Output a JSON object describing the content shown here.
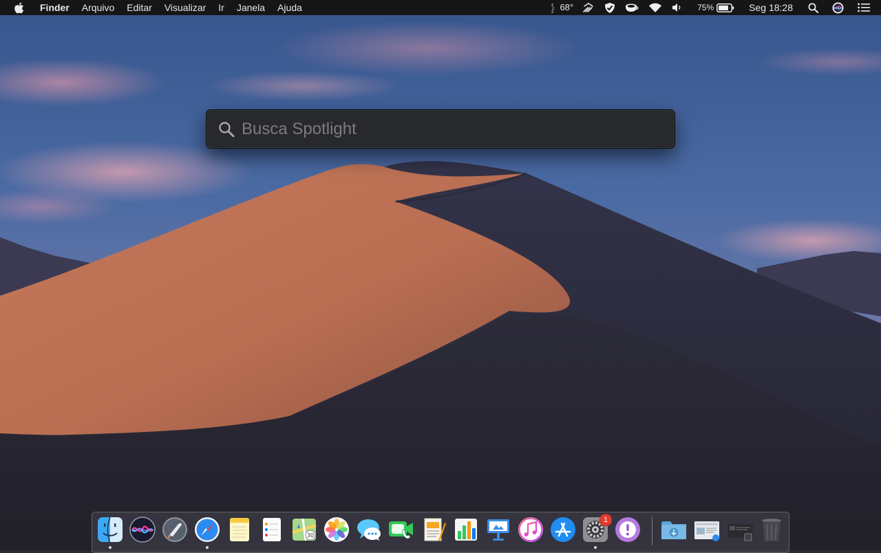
{
  "menubar": {
    "app_name": "Finder",
    "menus": [
      "Arquivo",
      "Editar",
      "Visualizar",
      "Ir",
      "Janela",
      "Ajuda"
    ],
    "status": {
      "weather_temp": "68°",
      "battery_percent": "75%",
      "clock": "Seg 18:28"
    },
    "icons": [
      "apple-icon",
      "zzz-weather-icon",
      "bluetooth-signal-icon",
      "shield-icon",
      "coffee-cup-icon",
      "wifi-icon",
      "volume-icon",
      "battery-icon",
      "search-icon",
      "siri-icon",
      "notification-center-icon"
    ]
  },
  "spotlight": {
    "placeholder": "Busca Spotlight",
    "value": ""
  },
  "dock": {
    "apps": [
      {
        "name": "Finder",
        "icon": "finder-icon",
        "running": true
      },
      {
        "name": "Siri",
        "icon": "siri-icon",
        "running": false
      },
      {
        "name": "Launchpad",
        "icon": "launchpad-icon",
        "running": false
      },
      {
        "name": "Safari",
        "icon": "safari-icon",
        "running": true
      },
      {
        "name": "Notes",
        "icon": "notes-icon",
        "running": false
      },
      {
        "name": "Reminders",
        "icon": "reminders-icon",
        "running": false
      },
      {
        "name": "Maps",
        "icon": "maps-icon",
        "running": false
      },
      {
        "name": "Photos",
        "icon": "photos-icon",
        "running": false
      },
      {
        "name": "Messages",
        "icon": "messages-icon",
        "running": false
      },
      {
        "name": "FaceTime",
        "icon": "facetime-icon",
        "running": false
      },
      {
        "name": "Pages",
        "icon": "pages-icon",
        "running": false
      },
      {
        "name": "Numbers",
        "icon": "numbers-icon",
        "running": false
      },
      {
        "name": "Keynote",
        "icon": "keynote-icon",
        "running": false
      },
      {
        "name": "iTunes",
        "icon": "itunes-icon",
        "running": false
      },
      {
        "name": "App Store",
        "icon": "app-store-icon",
        "running": false
      },
      {
        "name": "System Preferences",
        "icon": "system-preferences-icon",
        "running": true,
        "badge": "1"
      },
      {
        "name": "Feedback Assistant",
        "icon": "feedback-icon",
        "running": false
      },
      {
        "name": "Downloads",
        "icon": "downloads-folder-icon",
        "running": false
      },
      {
        "name": "Document",
        "icon": "document-stack-icon",
        "running": false
      },
      {
        "name": "Screenshot",
        "icon": "screenshot-stack-icon",
        "running": false
      },
      {
        "name": "Trash",
        "icon": "trash-icon",
        "running": false
      }
    ]
  }
}
